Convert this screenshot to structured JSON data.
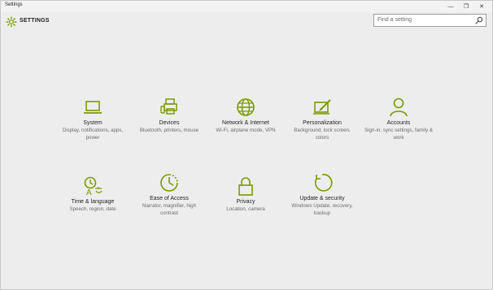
{
  "window": {
    "title": "Settings",
    "minimize_glyph": "—",
    "maximize_glyph": "❐",
    "close_glyph": "✕"
  },
  "header": {
    "heading": "SETTINGS",
    "icon": "gear-icon"
  },
  "search": {
    "placeholder": "Find a setting",
    "icon": "search-icon"
  },
  "accent_color": "#7a9a01",
  "categories": [
    {
      "label": "System",
      "description": "Display, notifications, apps, power",
      "icon": "laptop-icon"
    },
    {
      "label": "Devices",
      "description": "Bluetooth, printers, mouse",
      "icon": "devices-icon"
    },
    {
      "label": "Network & Internet",
      "description": "Wi-Fi, airplane mode, VPN",
      "icon": "globe-icon"
    },
    {
      "label": "Personalization",
      "description": "Background, lock screen, colors",
      "icon": "paint-icon"
    },
    {
      "label": "Accounts",
      "description": "Sign-in, sync settings, family & work",
      "icon": "person-icon"
    },
    {
      "label": "Time & language",
      "description": "Speech, region, date",
      "icon": "clock-language-icon"
    },
    {
      "label": "Ease of Access",
      "description": "Narrator, magnifier, high contrast",
      "icon": "ease-of-access-icon"
    },
    {
      "label": "Privacy",
      "description": "Location, camera",
      "icon": "lock-icon"
    },
    {
      "label": "Update & security",
      "description": "Windows Update, recovery, backup",
      "icon": "refresh-icon"
    }
  ]
}
